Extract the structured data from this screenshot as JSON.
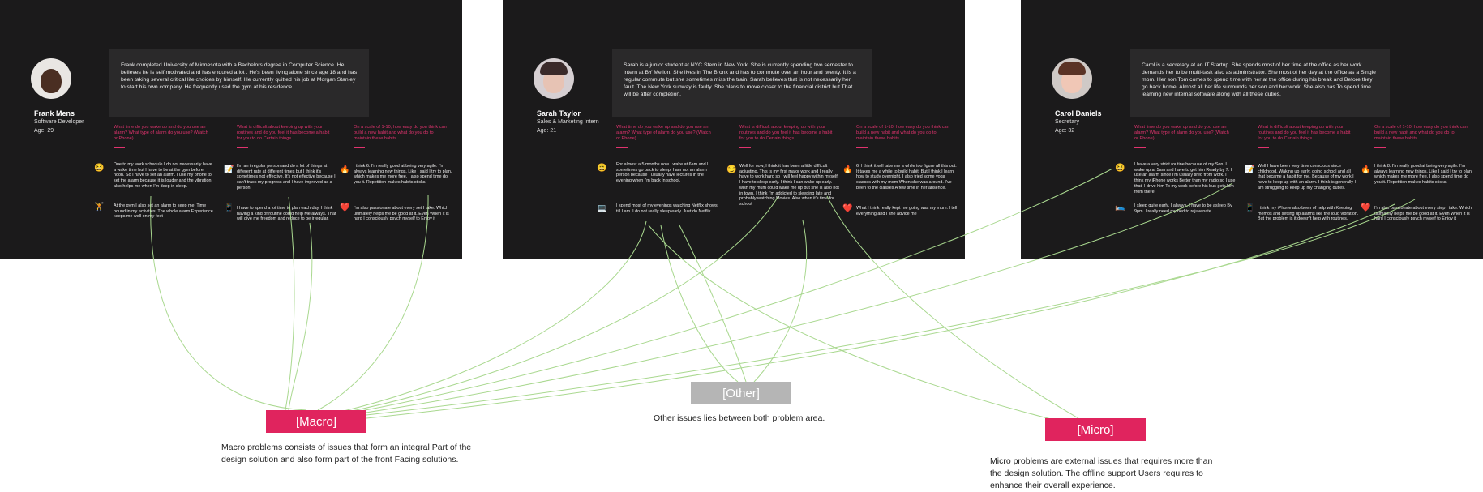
{
  "personas": [
    {
      "name": "Frank Mens",
      "role": "Software Developer",
      "age": "Age: 29",
      "bio": "Frank completed University of Minnesota with a Bachelors degree in Computer Science. He believes he is self motivated and has endured a lot . He's been living alone since age 18 and has been taking several critical life choices by himself. He currently quitted his job at Morgan Stanley to start his own company. He frequently used the gym at his residence.",
      "questions": [
        "What time do you wake up and do you use an alarm? What type of alarm do you use? (Watch or Phone)",
        "What is difficult about keeping up with your routines and do you feel it has become a habit for you to do Certain things.",
        "On a scale of 1-10, how easy do you think can build a new habit and what do you do to maintain these habits."
      ],
      "answers": [
        "Due to my work schedule I do not necessarily have a wake time but I have to be at the gym before noon. So I have to set an alarm. I use my phone to set the alarm because it is louder and the vibration also helps me when I'm deep in sleep.",
        "At the gym I also set an alarm to keep me. Time bound in my activities. The whole alarm Experience keeps me well on my feet",
        "I'm an irregular person and do a lot of things at different rate at different times but I think it's sometimes not effective. It's not effective because I can't track my progress and I have improved as a person",
        "I have to spend a lot time to plan each day. I think having a kind of routine could help Me always. That will give me freedom and reduce to be irregular.",
        "I think 6. I'm really good at being very agile. I'm always learning new things. Like I said I try to plan, which makes me more free. I also spend time do you it. Repetition makes habits sticks.",
        "I'm also passionate about every set I take. Which ultimately helps me be good at it. Even When it is hard I consciously psych myself to Enjoy it"
      ]
    },
    {
      "name": "Sarah Taylor",
      "role": "Sales & Marketing Intern",
      "age": "Age: 21",
      "bio": "Sarah is a junior student at NYC Stern in New York. She is currently spending two semester to intern at BY Mellon. She lives in The Bronx and has to commute over an hour and twenty. It is a regular commute but she sometimes miss the train. Sarah believes that is not necessarily her fault. The New York subway is faulty. She plans to move closer to the financial district but That will be after completion.",
      "questions": [
        "What time do you wake up and do you use an alarm? What type of alarm do you use? (Watch or Phone)",
        "What is difficult about keeping up with your routines and do you feel it has become a habit for you to do Certain things.",
        "On a scale of 1-10, how easy do you think can build a new habit and what do you do to maintain these habits."
      ],
      "answers": [
        "For almost a 5 months now I wake at 6am and I sometimes go back to sleep. I am not an alarm person because I usually have lectures in the evening when I'm back In school.",
        "I spend most of my evenings watching Netflix shows till I am. I do not really sleep early. Just do Netflix.",
        "Well for now, I think it has been a little difficult adjusting. This is my first major work and I really have to work hard so I will feel happy within myself. I have to sleep early. I think I can wake up early. I wish my mum could wake me up but she is also not in town. I think I'm addicted to sleeping late and probably watching Movies. Also when it's time for school",
        "6. I think it will take me a while too figure all this out. It takes me a while to build habit. But I think I learn how to study overnight. I also tried some yoga classes with my mom When she was around. I've been to the classes A few time in her absence.",
        "What I think really kept me going was my mum. I tell everything and I she advice me"
      ]
    },
    {
      "name": "Carol Daniels",
      "role": "Secretary",
      "age": "Age: 32",
      "bio": "Carol is a secretary at an IT Startup. She spends most of her time at the office as her work demands her to be multi-task also as administrator. She most of her day at the office as a Single mom. Her son Tom comes to spend time with her at the office during his break and Before they go back home. Almost all her life surrounds her son and her work. She also has To spend time learning new internal software along with all these duties.",
      "questions": [
        "What time do you wake up and do you use an alarm? What type of alarm do you use? (Watch or Phone)",
        "What is difficult about keeping up with your routines and do you feel it has become a habit for you to do Certain things.",
        "On a scale of 1-10, how easy do you think can build a new habit and what do you do to maintain these habits."
      ],
      "answers": [
        "I have a very strict routine because of my Son. I wake up at 5am and have to get him Ready by 7. I use an alarm since I'm usually tired from work. I think my iPhone works Better than my radio so I use that. I drive him To my work before his bus gets him from there.",
        "I sleep quite early. I always, I have to be asleep By 9pm. I really need my bed to rejuvenate.",
        "Well I have been very time conscious since childhood. Waking up early, doing school and all that became a habit for me. Because of my work I have to keep up with an alarm. I think is generally I am struggling to keep up my changing duties.",
        "I think my iPhone also been of help with Keeping memos and setting up alarms like the loud vibration. But the problem is it doesn't help with routines.",
        "I think 8. I'm really good at being very agile. I'm always learning new things. Like I said I try to plan, which makes me more free. I also spend time do you it. Repetition makes habits sticks.",
        "I'm also passionate about every step I take. Which ultimately helps me be good at it. Even When it is hard I consciously psych myself to Enjoy it"
      ]
    }
  ],
  "categories": {
    "macro": {
      "label": "[Macro]",
      "description": "Macro problems consists of issues that form an integral Part of the design solution and also form part of the front Facing solutions.",
      "color": "#e0245e"
    },
    "other": {
      "label": "[Other]",
      "description": "Other issues lies between both problem area.",
      "color": "#b5b5b5"
    },
    "micro": {
      "label": "[Micro]",
      "description": "Micro problems are external issues that requires more than the design solution. The offline support Users requires to enhance their overall experience.",
      "color": "#e0245e"
    }
  },
  "icons": [
    "tired-face-icon",
    "weightlifter-icon",
    "notepad-icon",
    "phone-icon",
    "fire-icon",
    "heart-icon",
    "smirk-face-icon",
    "laptop-icon",
    "sleeping-icon"
  ],
  "colors": {
    "panel": "#1b1a1b",
    "accent": "#e0336e",
    "highlight": "#8fd46a",
    "link": "#a9d88f"
  }
}
